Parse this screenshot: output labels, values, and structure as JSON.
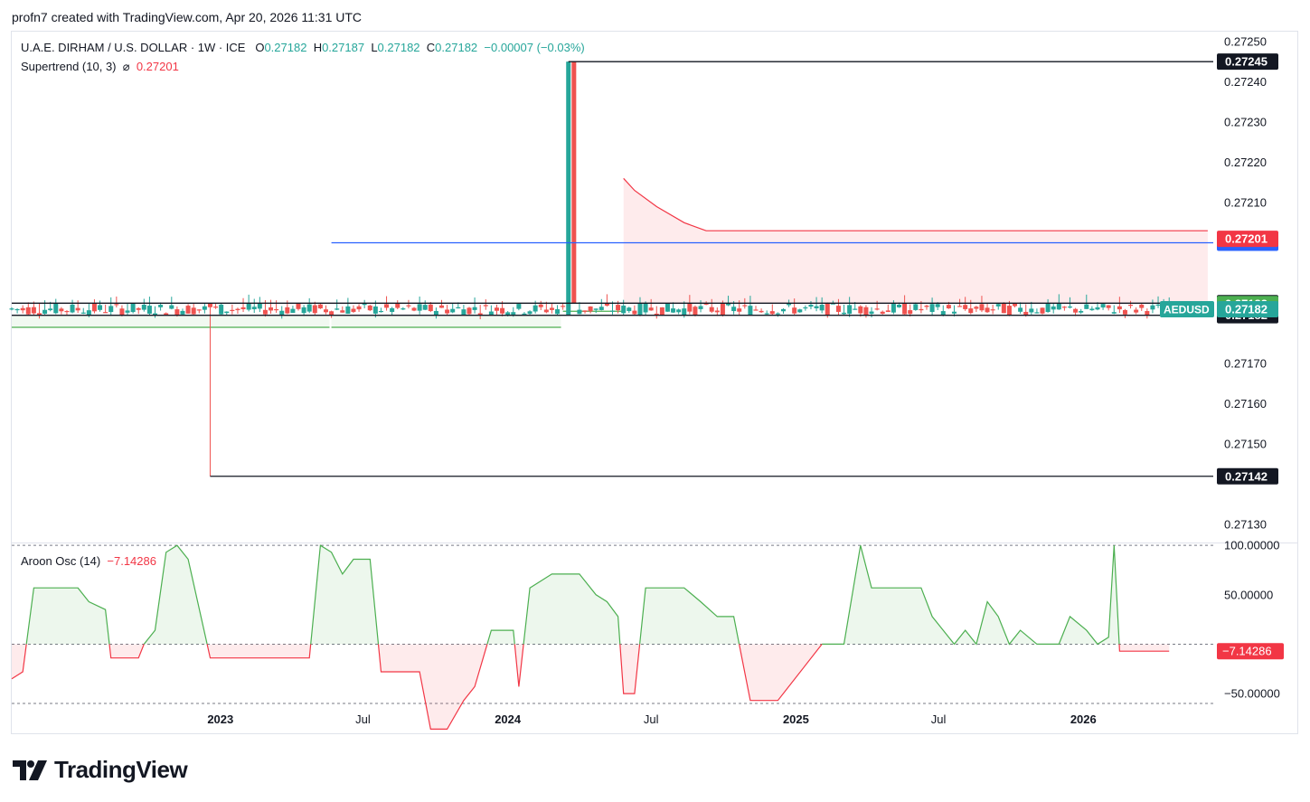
{
  "header": {
    "author_line": "profn7 created with TradingView.com, Apr 20, 2026 11:31 UTC"
  },
  "legend": {
    "symbol": "U.A.E. DIRHAM / U.S. DOLLAR · 1W · ICE",
    "o_label": "O",
    "o_value": "0.27182",
    "h_label": "H",
    "h_value": "0.27187",
    "l_label": "L",
    "l_value": "0.27182",
    "c_label": "C",
    "c_value": "0.27182",
    "change": "−0.00007 (−0.03%)",
    "supertrend_label": "Supertrend (10, 3)",
    "supertrend_symbol": "⌀",
    "supertrend_value": "0.27201",
    "aroon_label": "Aroon Osc (14)",
    "aroon_value": "−7.14286"
  },
  "colors": {
    "up": "#26a69a",
    "down": "#ef5350",
    "supertrend_up": "#4caf50",
    "supertrend_down": "#f23645",
    "level": "#131722",
    "blue_level": "#2962ff",
    "aroon_up": "#4caf50",
    "aroon_down": "#f23645"
  },
  "footer": {
    "brand": "TradingView",
    "logo_icon": "tradingview-logo-icon"
  },
  "chart_data": [
    {
      "type": "candlestick",
      "title": "U.A.E. DIRHAM / U.S. DOLLAR · 1W · ICE",
      "symbol_tag": "AEDUSD",
      "y_ticks": [
        "0.27250",
        "0.27240",
        "0.27230",
        "0.27220",
        "0.27210",
        "0.27170",
        "0.27160",
        "0.27150",
        "0.27130"
      ],
      "ylim": [
        0.27126,
        0.27252
      ],
      "x_ticks": [
        "2023",
        "Jul",
        "2024",
        "Jul",
        "2025",
        "Jul",
        "2026"
      ],
      "x_tick_dates": [
        "2023-01-01",
        "2023-07-01",
        "2024-01-01",
        "2024-07-01",
        "2025-01-01",
        "2025-07-01",
        "2026-01-01"
      ],
      "x_range": [
        "2022-04-11",
        "2026-06-15"
      ],
      "typical_range": {
        "low": 0.27182,
        "high": 0.27185
      },
      "spikes": [
        {
          "date": "2022-12-19",
          "low": 0.27142,
          "high": 0.27185,
          "direction": "down"
        },
        {
          "date": "2024-03-18",
          "low": 0.27182,
          "high": 0.27245,
          "direction": "up"
        },
        {
          "date": "2024-03-25",
          "low": 0.27185,
          "high": 0.27245,
          "direction": "down"
        }
      ],
      "horizontal_levels": [
        {
          "label": "0.27245",
          "value": 0.27245,
          "from": "2024-03-18",
          "color": "dark"
        },
        {
          "label": "0.27200",
          "value": 0.272,
          "from": "2023-05-22",
          "color": "blue"
        },
        {
          "label": "0.27185",
          "value": 0.27185,
          "from": "2022-04-11",
          "color": "dark"
        },
        {
          "label": "0.27182",
          "value": 0.27182,
          "from": "2022-04-11",
          "color": "dark"
        },
        {
          "label": "0.27142",
          "value": 0.27142,
          "from": "2022-12-19",
          "color": "dark"
        }
      ],
      "price_tags": [
        {
          "label": "0.27201",
          "value": 0.27201,
          "color": "red"
        },
        {
          "label": "0.27183",
          "value": 0.27183,
          "color": "green"
        },
        {
          "label": "0.27182",
          "value": 0.27182,
          "color": "teal"
        }
      ],
      "supertrend": {
        "name": "Supertrend (10, 3)",
        "up_segments": [
          {
            "from": "2022-04-11",
            "to": "2023-05-15",
            "value": 0.27179
          },
          {
            "from": "2023-05-22",
            "to": "2024-03-04",
            "value": 0.27179
          },
          {
            "from": "2024-03-11",
            "to": "2024-05-20",
            "value": 0.27183
          }
        ],
        "down_segment": [
          {
            "date": "2024-05-27",
            "value": 0.27216
          },
          {
            "date": "2024-06-10",
            "value": 0.27213
          },
          {
            "date": "2024-07-08",
            "value": 0.27209
          },
          {
            "date": "2024-08-12",
            "value": 0.27205
          },
          {
            "date": "2024-09-09",
            "value": 0.27203
          },
          {
            "date": "2026-06-08",
            "value": 0.27203
          }
        ]
      }
    },
    {
      "type": "line",
      "title": "Aroon Osc (14)",
      "y_ticks": [
        "100.00000",
        "50.00000",
        "-50.00000"
      ],
      "ylim": [
        -60,
        102
      ],
      "series": [
        {
          "name": "Aroon Osc (14)",
          "points": [
            [
              "2022-04-11",
              -35
            ],
            [
              "2022-04-25",
              -28
            ],
            [
              "2022-05-09",
              57
            ],
            [
              "2022-06-06",
              57
            ],
            [
              "2022-07-04",
              57
            ],
            [
              "2022-07-18",
              43
            ],
            [
              "2022-08-08",
              35
            ],
            [
              "2022-08-15",
              -14
            ],
            [
              "2022-09-19",
              -14
            ],
            [
              "2022-09-26",
              0
            ],
            [
              "2022-10-10",
              14
            ],
            [
              "2022-10-24",
              93
            ],
            [
              "2022-11-07",
              100
            ],
            [
              "2022-11-21",
              86
            ],
            [
              "2022-12-19",
              -14
            ],
            [
              "2023-04-24",
              -14
            ],
            [
              "2023-05-08",
              100
            ],
            [
              "2023-05-22",
              93
            ],
            [
              "2023-06-05",
              71
            ],
            [
              "2023-06-19",
              86
            ],
            [
              "2023-07-10",
              86
            ],
            [
              "2023-07-24",
              -28
            ],
            [
              "2023-09-11",
              -28
            ],
            [
              "2023-09-25",
              -86
            ],
            [
              "2023-10-16",
              -86
            ],
            [
              "2023-11-06",
              -57
            ],
            [
              "2023-11-20",
              -43
            ],
            [
              "2023-12-11",
              14
            ],
            [
              "2024-01-08",
              14
            ],
            [
              "2024-01-15",
              -43
            ],
            [
              "2024-01-29",
              57
            ],
            [
              "2024-02-26",
              71
            ],
            [
              "2024-04-01",
              71
            ],
            [
              "2024-04-22",
              50
            ],
            [
              "2024-05-06",
              43
            ],
            [
              "2024-05-20",
              28
            ],
            [
              "2024-05-27",
              -50
            ],
            [
              "2024-06-10",
              -50
            ],
            [
              "2024-06-24",
              57
            ],
            [
              "2024-08-12",
              57
            ],
            [
              "2024-09-02",
              43
            ],
            [
              "2024-09-23",
              28
            ],
            [
              "2024-10-14",
              28
            ],
            [
              "2024-11-04",
              -57
            ],
            [
              "2024-12-09",
              -57
            ],
            [
              "2025-02-03",
              0
            ],
            [
              "2025-03-03",
              0
            ],
            [
              "2025-03-24",
              100
            ],
            [
              "2025-04-07",
              57
            ],
            [
              "2025-05-05",
              57
            ],
            [
              "2025-06-09",
              57
            ],
            [
              "2025-06-23",
              28
            ],
            [
              "2025-07-07",
              14
            ],
            [
              "2025-07-21",
              0
            ],
            [
              "2025-08-04",
              14
            ],
            [
              "2025-08-18",
              0
            ],
            [
              "2025-09-01",
              43
            ],
            [
              "2025-09-15",
              28
            ],
            [
              "2025-09-29",
              0
            ],
            [
              "2025-10-13",
              14
            ],
            [
              "2025-11-03",
              0
            ],
            [
              "2025-12-01",
              0
            ],
            [
              "2025-12-15",
              28
            ],
            [
              "2026-01-05",
              14
            ],
            [
              "2026-01-19",
              0
            ],
            [
              "2026-02-02",
              7
            ],
            [
              "2026-02-09",
              100
            ],
            [
              "2026-02-16",
              -7.14286
            ],
            [
              "2026-04-20",
              -7.14286
            ]
          ]
        }
      ]
    }
  ]
}
